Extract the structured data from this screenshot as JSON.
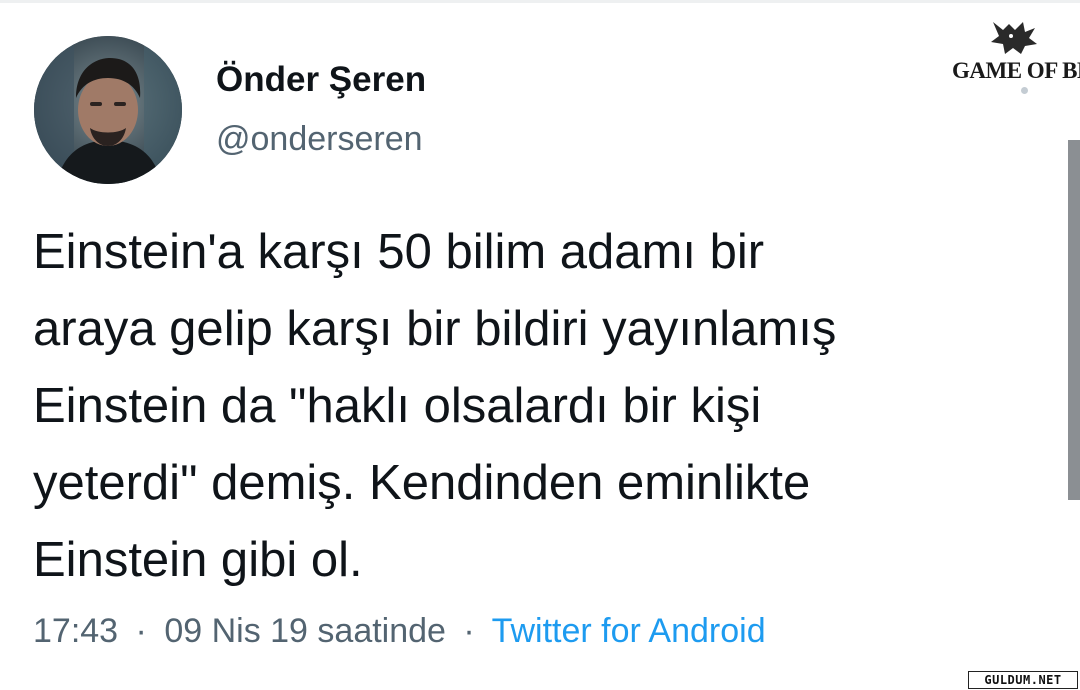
{
  "profile": {
    "display_name": "Önder Şeren",
    "handle": "@onderseren",
    "avatar_icon": "person-photo"
  },
  "tweet": {
    "lines": [
      "Einstein'a karşı 50 bilim adamı bir",
      "araya gelip karşı bir bildiri yayınlamış",
      "Einstein da \"haklı olsalardı bir kişi",
      "yeterdi\" demiş. Kendinden eminlikte",
      "Einstein gibi ol."
    ]
  },
  "meta": {
    "time": "17:43",
    "date": "09 Nis 19 saatinde",
    "separator": "·",
    "source": "Twitter for Android"
  },
  "watermarks": {
    "top_right": "GAME OF BET",
    "bottom_right": "GULDUM.NET",
    "top_right_icon": "wolf-head"
  },
  "colors": {
    "text": "#0f1419",
    "secondary": "#536471",
    "link": "#1d9bf0"
  }
}
